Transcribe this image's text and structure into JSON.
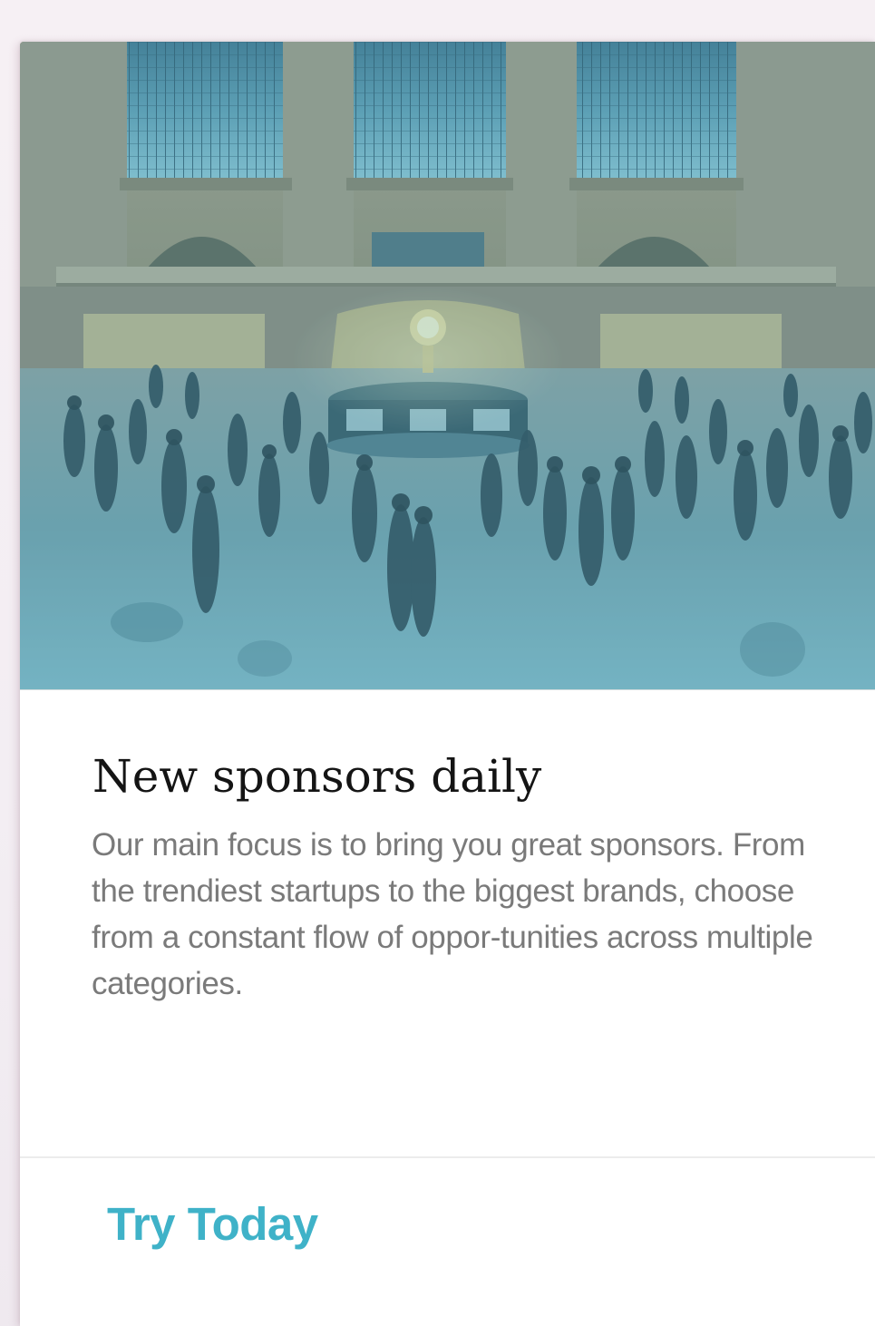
{
  "card": {
    "title": "New sponsors daily",
    "description": "Our main focus is to bring you great sponsors. From the trendiest startups to the biggest brands, choose from a constant flow of oppor-tunities across multiple categories.",
    "action_label": "Try Today",
    "image": {
      "subject": "busy train station concourse with central clock kiosk and arched windows",
      "tint": "#5fb4c8"
    }
  },
  "colors": {
    "accent": "#3fb2c8",
    "title": "#141414",
    "body_text": "#7a7a7a",
    "divider": "#ececec"
  }
}
